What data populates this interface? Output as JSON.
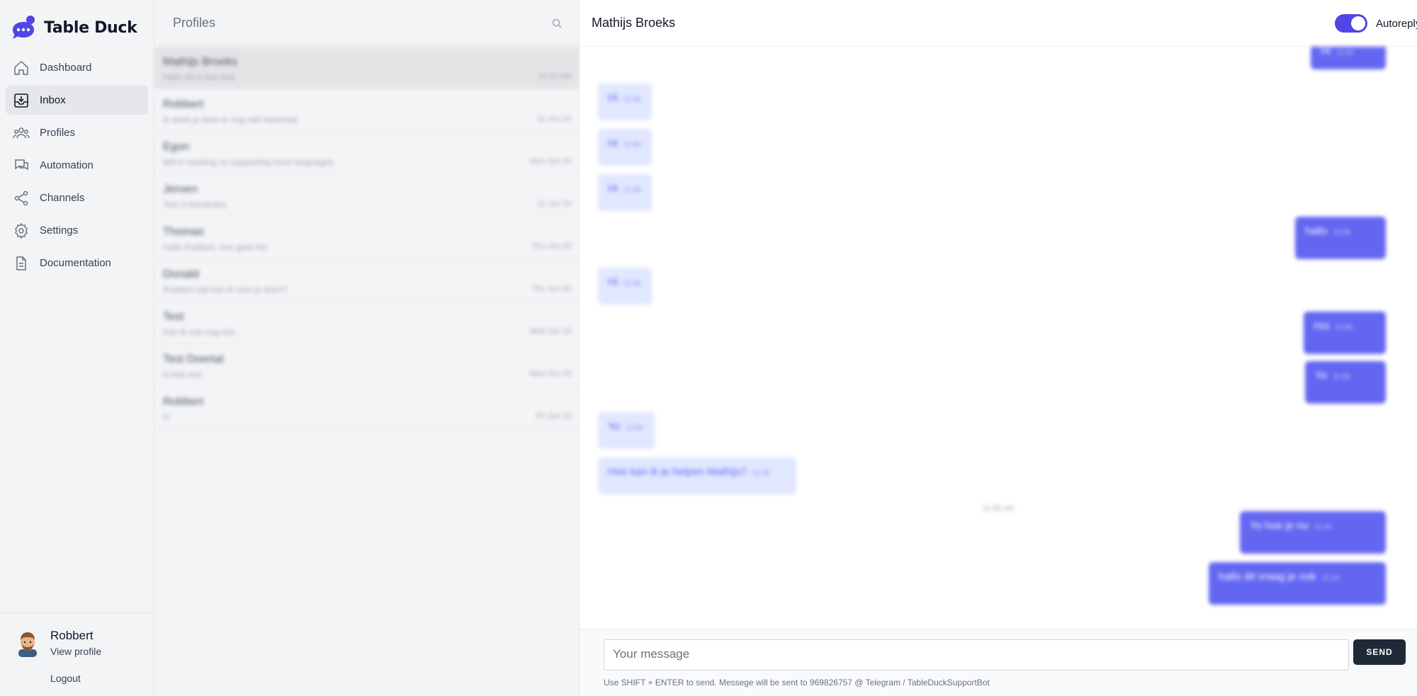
{
  "brand": {
    "name": "Table Duck",
    "accent": "#4f46e5"
  },
  "sidebar": {
    "items": [
      {
        "label": "Dashboard",
        "icon": "home-icon",
        "active": false
      },
      {
        "label": "Inbox",
        "icon": "inbox-icon",
        "active": true
      },
      {
        "label": "Profiles",
        "icon": "users-icon",
        "active": false
      },
      {
        "label": "Automation",
        "icon": "chat-bubbles-icon",
        "active": false
      },
      {
        "label": "Channels",
        "icon": "share-icon",
        "active": false
      },
      {
        "label": "Settings",
        "icon": "gear-icon",
        "active": false
      },
      {
        "label": "Documentation",
        "icon": "document-icon",
        "active": false
      }
    ],
    "user": {
      "name": "Robbert",
      "view_profile": "View profile",
      "logout": "Logout"
    }
  },
  "list": {
    "title": "Profiles",
    "items": [
      {
        "name": "Mathijs Broeks",
        "preview": "Hallo dit is een test",
        "time": "11:16 AM",
        "active": true
      },
      {
        "name": "Robbert",
        "preview": "Ik denk je bent er nog niet helemaal",
        "time": "11 Jun 24",
        "active": false
      },
      {
        "name": "Egon",
        "preview": "We're working on supporting more languages",
        "time": "Mon Jun 24",
        "active": false
      },
      {
        "name": "Jeroen",
        "preview": "Test 3 hahahaha",
        "time": "11 Jun 24",
        "active": false
      },
      {
        "name": "Thomas",
        "preview": "Hallo Robbert, hoe gaat het",
        "time": "Thu Jun 20",
        "active": false
      },
      {
        "name": "Donald",
        "preview": "Robbert wat kan ik voor je doen?",
        "time": "Thu Jun 20",
        "active": false
      },
      {
        "name": "Test",
        "preview": "Kan ik ook nog iets",
        "time": "Wed Jun 19",
        "active": false
      },
      {
        "name": "Test Doertal",
        "preview": "ik heb een",
        "time": "Wed Jun 19",
        "active": false
      },
      {
        "name": "Robbert",
        "preview": "hi",
        "time": "Fri Jun 14",
        "active": false
      }
    ]
  },
  "chat": {
    "title": "Mathijs Broeks",
    "autoreply_label": "Autoreply",
    "autoreply_on": true,
    "messages": [
      {
        "dir": "out",
        "text": "Hi",
        "time": "11:06"
      },
      {
        "dir": "in",
        "text": "Hi",
        "time": "11:06"
      },
      {
        "dir": "in",
        "text": "Hi",
        "time": "11:06"
      },
      {
        "dir": "in",
        "text": "Hi",
        "time": "11:06"
      },
      {
        "dir": "out",
        "text": "hallo",
        "time": "11:06"
      },
      {
        "dir": "in",
        "text": "Hi",
        "time": "11:06"
      },
      {
        "dir": "out",
        "text": "Hoi",
        "time": "11:06"
      },
      {
        "dir": "out",
        "text": "Yo",
        "time": "11:06"
      },
      {
        "dir": "in",
        "text": "Yo",
        "time": "11:06"
      },
      {
        "dir": "in",
        "text": "Hoe kan ik je helpen Mathijs?",
        "time": "11:06"
      },
      {
        "dir": "out",
        "text": "Yo hoe je nu",
        "time": "11:16"
      },
      {
        "dir": "out",
        "text": "hallo dit vraag je ook",
        "time": "11:16"
      }
    ],
    "day_separator": "11:06 am",
    "composer": {
      "placeholder": "Your message",
      "send_label": "SEND",
      "hint": "Use SHIFT + ENTER to send. Messege will be sent to 969826757 @ Telegram / TableDuckSupportBot"
    }
  }
}
